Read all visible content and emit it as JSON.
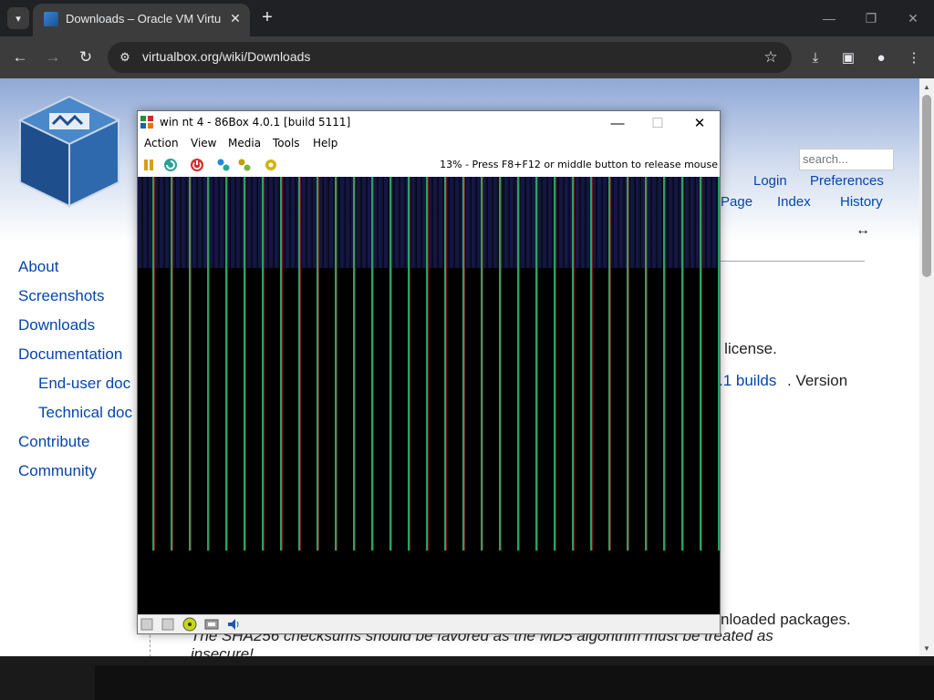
{
  "browser": {
    "tab_title": "Downloads – Oracle VM VirtualBox",
    "tab_close": "✕",
    "new_tab": "+",
    "url": "virtualbox.org/wiki/Downloads",
    "window_controls": {
      "minimize": "—",
      "restore": "❐",
      "close": "✕"
    },
    "nav": {
      "back": "←",
      "forward": "→",
      "reload": "↻"
    },
    "icons": [
      "site-info-icon",
      "bookmark-star-icon",
      "download-icon",
      "side-panel-icon",
      "profile-icon",
      "menu-icon"
    ]
  },
  "wiki": {
    "search_placeholder": "search...",
    "top_links": {
      "login": "Login",
      "preferences": "Preferences",
      "page": "Page",
      "index": "Index",
      "history": "History"
    },
    "arrow": "↔",
    "sidebar": [
      {
        "label": "About",
        "indent": false
      },
      {
        "label": "Screenshots",
        "indent": false
      },
      {
        "label": "Downloads",
        "indent": false
      },
      {
        "label": "Documentation",
        "indent": false
      },
      {
        "label": "End-user doc",
        "indent": true
      },
      {
        "label": "Technical doc",
        "indent": true
      },
      {
        "label": "Contribute",
        "indent": false
      },
      {
        "label": "Community",
        "indent": false
      }
    ],
    "body": {
      "license_tail": "e license.",
      "builds_link": ".1 builds",
      "builds_tail": ". Version",
      "packages_tail": "nloaded packages.",
      "sha_note_1": "The SHA256 checksums should be favored as the MD5 algorithm must be treated as",
      "sha_note_2": "insecure!"
    }
  },
  "vm": {
    "title": "win nt 4 - 86Box 4.0.1 [build 5111]",
    "menu": [
      "Action",
      "View",
      "Media",
      "Tools",
      "Help"
    ],
    "toolbar_icons": [
      "pause-icon",
      "reset-icon",
      "power-icon",
      "ctrl-alt-del-icon",
      "ctrl-alt-esc-icon",
      "settings-icon"
    ],
    "status_message": "13% - Press F8+F12 or middle button to release mouse",
    "statusbar_icons": [
      "floppy-a-icon",
      "floppy-b-icon",
      "cdrom-icon",
      "network-icon",
      "sound-icon"
    ],
    "controls": {
      "minimize": "—",
      "maximize": "☐",
      "close": "✕"
    }
  }
}
